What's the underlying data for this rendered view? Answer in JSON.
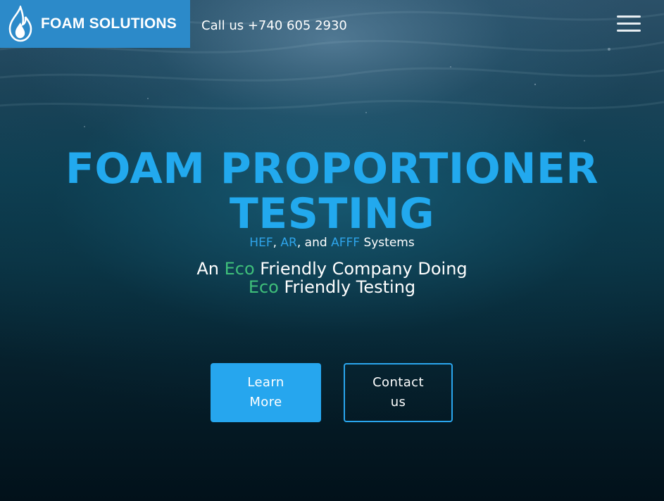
{
  "brand": {
    "name": "FOAM SOLUTIONS",
    "logo_icon": "flame-droplet-icon",
    "bar_color": "#2c8ac9"
  },
  "header": {
    "phone_text": "Call us +740 605 2930",
    "menu_icon": "hamburger-menu-icon"
  },
  "hero": {
    "headline_line1": "FOAM PROPORTIONER",
    "headline_line2": "TESTING",
    "systems": {
      "item1": "HEF",
      "sep1": ", ",
      "item2": "AR",
      "sep2": ", and ",
      "item3": "AFFF",
      "suffix": " Systems"
    },
    "tagline": {
      "line1_prefix": "An ",
      "line1_eco": "Eco",
      "line1_suffix": " Friendly Company Doing",
      "line2_eco": "Eco",
      "line2_suffix": " Friendly Testing"
    },
    "accent_blue": "#22a9ee",
    "accent_green": "#3fbf7a"
  },
  "actions": {
    "learn_more_line1": "Learn",
    "learn_more_line2": "More",
    "contact_line1": "Contact",
    "contact_line2": "us"
  }
}
